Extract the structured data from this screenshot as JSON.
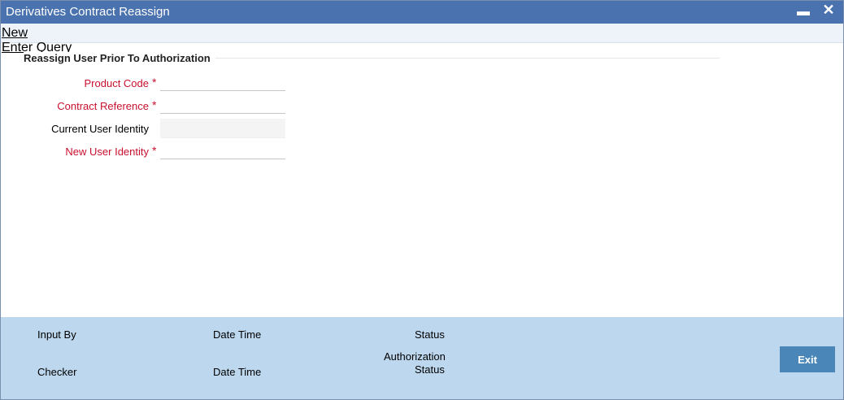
{
  "window": {
    "title": "Derivatives Contract Reassign",
    "minimize_glyph": "▬",
    "close_glyph": "✕"
  },
  "menu": {
    "new_label": "New",
    "enter_query_label": "Enter Query"
  },
  "section": {
    "title": "Reassign User Prior To Authorization"
  },
  "fields": {
    "product_code": {
      "label": "Product Code",
      "value": "",
      "required": true
    },
    "contract_reference": {
      "label": "Contract Reference",
      "value": "",
      "required": true
    },
    "current_user_identity": {
      "label": "Current User Identity",
      "value": "",
      "required": false
    },
    "new_user_identity": {
      "label": "New User Identity",
      "value": "",
      "required": true
    },
    "required_marker": "*"
  },
  "footer": {
    "input_by_label": "Input By",
    "date_time_label_1": "Date Time",
    "status_label": "Status",
    "checker_label": "Checker",
    "date_time_label_2": "Date Time",
    "authorization_status_line1": "Authorization",
    "authorization_status_line2": "Status",
    "exit_label": "Exit"
  },
  "colors": {
    "titlebar": "#4a72ae",
    "required_label": "#c8102e",
    "footer": "#bdd8ee",
    "exit_button": "#4a86b8"
  }
}
